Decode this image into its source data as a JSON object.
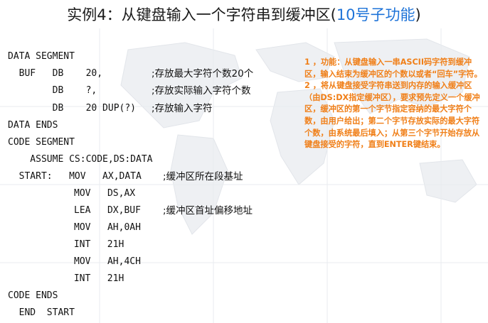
{
  "title": {
    "prefix": "实例4：从键盘输入一个字符串到缓冲区(",
    "highlight": "10号子功能",
    "suffix": ")"
  },
  "code": {
    "data_segment": "DATA SEGMENT",
    "buf_line": "  BUF   DB    20,",
    "buf_comment": ";存放最大字符个数20个",
    "db2_line": "        DB    ?,",
    "db2_comment": ";存放实际输入字符个数",
    "db3_line": "        DB    20 DUP(?)",
    "db3_comment": ";存放输入字符",
    "data_ends": "DATA ENDS",
    "code_segment": "CODE SEGMENT",
    "assume": "    ASSUME CS:CODE,DS:DATA",
    "start_line": "  START:   MOV   AX,DATA",
    "start_comment": ";缓冲区所在段基址",
    "mov_ds": "MOV   DS,AX",
    "lea": "LEA   DX,BUF",
    "lea_comment": ";缓冲区首址偏移地址",
    "mov_ah0a": "MOV   AH,0AH",
    "int1": " INT   21H",
    "mov_ah4c": "MOV   AH,4CH",
    "int2": " INT   21H",
    "code_ends": "CODE ENDS",
    "end_start": "  END  START"
  },
  "notes": {
    "p1": "1 ，功能：从键盘输入一串ASCII码字符到缓冲区，输入结束为缓冲区的个数以或者“回车”字符。",
    "p2": "2 ，将从键盘接受字符串送到内存的输入缓冲区（由DS:DX指定缓冲区），要求预先定义一个缓冲区，缓冲区的第一个字节指定容纳的最大字符个数，由用户给出；第二个字节存放实际的最大字符个数，由系统最后填入；从第三个字节开始存放从键盘接受的字符，直到ENTER键结束。"
  }
}
